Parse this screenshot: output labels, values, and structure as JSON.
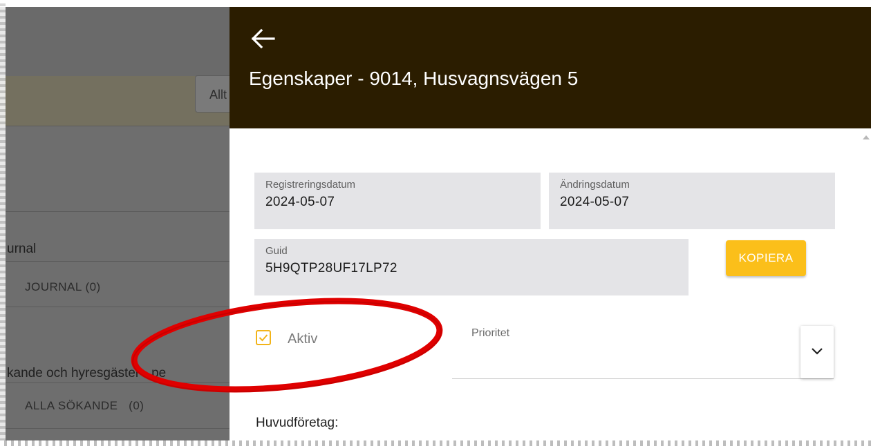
{
  "background_page": {
    "filter_text": "Allt",
    "journal_heading": "urnal",
    "journal_item": "JOURNAL (0)",
    "applicants_heading": "kande och hyresgäster - pe",
    "applicants_item": "ALLA SÖKANDE   (0)"
  },
  "drawer": {
    "back_icon": "arrow-left-icon",
    "title": "Egenskaper - 9014, Husvagnsvägen 5",
    "registration": {
      "label": "Registreringsdatum",
      "value": "2024-05-07"
    },
    "modified": {
      "label": "Ändringsdatum",
      "value": "2024-05-07"
    },
    "guid": {
      "label": "Guid",
      "value": "5H9QTP28UF17LP72"
    },
    "copy_button": "KOPIERA",
    "aktiv": {
      "label": "Aktiv",
      "checked": true
    },
    "prioritet": {
      "label": "Prioritet",
      "value": "",
      "icon": "chevron-down-icon"
    },
    "huvudforetag_label": "Huvudföretag:"
  },
  "colors": {
    "header_bg": "#2b1d00",
    "accent": "#fbbf1a",
    "field_bg": "#e4e4e7",
    "annotation": "#e00000"
  }
}
